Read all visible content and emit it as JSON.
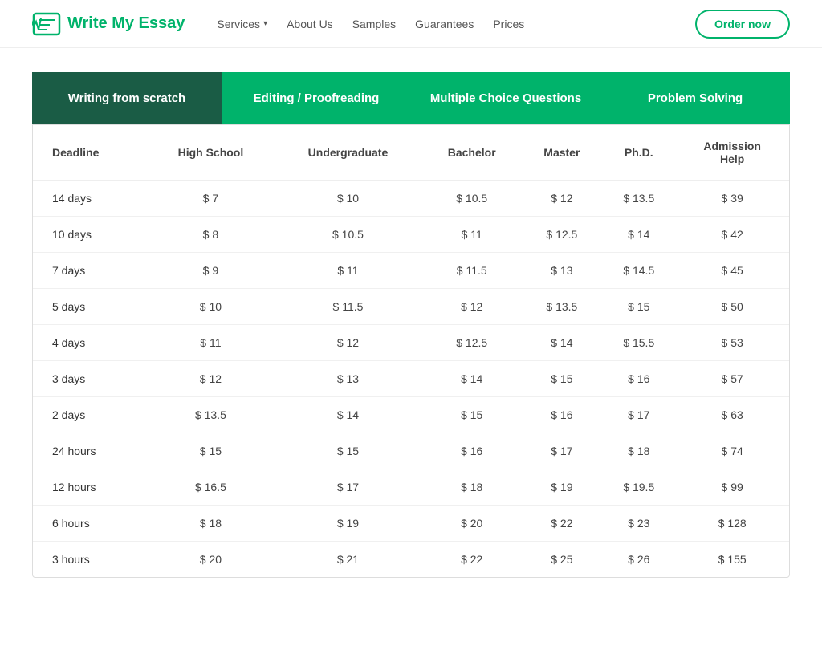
{
  "logo": {
    "text": "Write My Essay"
  },
  "nav": {
    "services_label": "Services",
    "about_label": "About Us",
    "samples_label": "Samples",
    "guarantees_label": "Guarantees",
    "prices_label": "Prices",
    "order_label": "Order now"
  },
  "tabs": [
    {
      "id": "writing",
      "label": "Writing from scratch",
      "active": true
    },
    {
      "id": "editing",
      "label": "Editing / Proofreading",
      "active": false
    },
    {
      "id": "multiple",
      "label": "Multiple Choice Questions",
      "active": false
    },
    {
      "id": "problem",
      "label": "Problem Solving",
      "active": false
    }
  ],
  "table": {
    "columns": [
      "Deadline",
      "High School",
      "Undergraduate",
      "Bachelor",
      "Master",
      "Ph.D.",
      "Admission Help"
    ],
    "rows": [
      [
        "14 days",
        "$ 7",
        "$ 10",
        "$ 10.5",
        "$ 12",
        "$ 13.5",
        "$ 39"
      ],
      [
        "10 days",
        "$ 8",
        "$ 10.5",
        "$ 11",
        "$ 12.5",
        "$ 14",
        "$ 42"
      ],
      [
        "7 days",
        "$ 9",
        "$ 11",
        "$ 11.5",
        "$ 13",
        "$ 14.5",
        "$ 45"
      ],
      [
        "5 days",
        "$ 10",
        "$ 11.5",
        "$ 12",
        "$ 13.5",
        "$ 15",
        "$ 50"
      ],
      [
        "4 days",
        "$ 11",
        "$ 12",
        "$ 12.5",
        "$ 14",
        "$ 15.5",
        "$ 53"
      ],
      [
        "3 days",
        "$ 12",
        "$ 13",
        "$ 14",
        "$ 15",
        "$ 16",
        "$ 57"
      ],
      [
        "2 days",
        "$ 13.5",
        "$ 14",
        "$ 15",
        "$ 16",
        "$ 17",
        "$ 63"
      ],
      [
        "24 hours",
        "$ 15",
        "$ 15",
        "$ 16",
        "$ 17",
        "$ 18",
        "$ 74"
      ],
      [
        "12 hours",
        "$ 16.5",
        "$ 17",
        "$ 18",
        "$ 19",
        "$ 19.5",
        "$ 99"
      ],
      [
        "6 hours",
        "$ 18",
        "$ 19",
        "$ 20",
        "$ 22",
        "$ 23",
        "$ 128"
      ],
      [
        "3 hours",
        "$ 20",
        "$ 21",
        "$ 22",
        "$ 25",
        "$ 26",
        "$ 155"
      ]
    ]
  }
}
